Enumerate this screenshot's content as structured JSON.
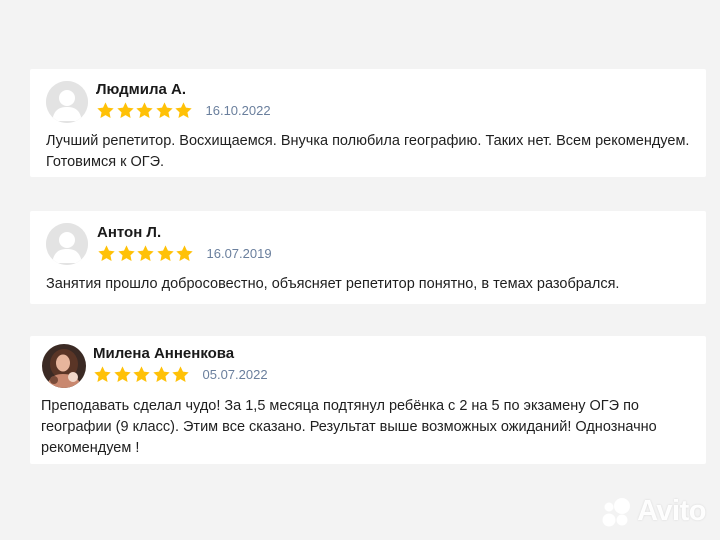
{
  "reviews": [
    {
      "author": "Людмила А.",
      "date": "16.10.2022",
      "rating": 5,
      "text": "Лучший репетитор. Восхищаемся. Внучка полюбила географию. Таких нет. Всем рекомендуем. Готовимся к ОГЭ.",
      "avatar": "default-user-icon"
    },
    {
      "author": "Антон Л.",
      "date": "16.07.2019",
      "rating": 5,
      "text": "Занятия прошло добросовестно, объясняет репетитор понятно, в темах разобрался.",
      "avatar": "default-user-icon"
    },
    {
      "author": "Милена Анненкова",
      "date": "05.07.2022",
      "rating": 5,
      "text": "Преподавать сделал чудо! За 1,5 месяца подтянул ребёнка с 2 на 5 по экзамену ОГЭ по географии (9 класс). Этим все сказано. Результат выше возможных ожиданий! Однозначно рекомендуем !",
      "avatar": "user-photo"
    }
  ],
  "watermark": {
    "text": "Avito"
  },
  "colors": {
    "background": "#f3f3f3",
    "card": "#ffffff",
    "star": "#ffc107",
    "date": "#6a7f9d",
    "text": "#1f1f1f"
  }
}
